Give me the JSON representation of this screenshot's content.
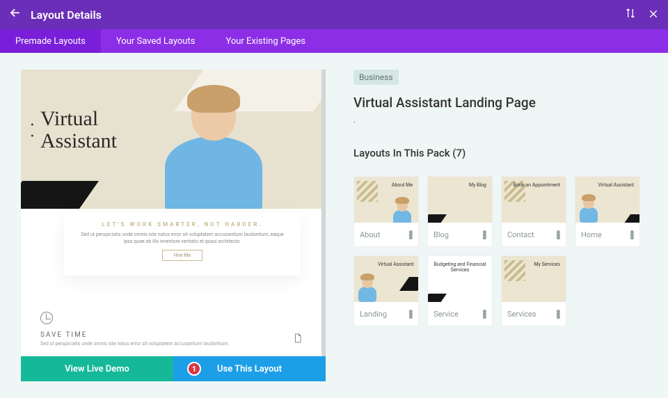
{
  "header": {
    "title": "Layout Details"
  },
  "tabs": {
    "premade": "Premade Layouts",
    "saved": "Your Saved Layouts",
    "existing": "Your Existing Pages"
  },
  "preview": {
    "heroLine1": "Virtual",
    "heroLine2": "Assistant",
    "cardTagline": "LET'S WORK SMARTER, NOT HARDER.",
    "cardText": "Sed ut perspiciatis unde omnis iste natus error sit voluptatem accusantium laudantium, eaque ipsa quae ab illo inventore veritatis et quasi architecto.",
    "cardBtn": "Hire Me",
    "saveHeading": "SAVE TIME",
    "saveText": "Sed ut perspiciatis unde omnis iste natus error sit voluptatem accusantium laudantium."
  },
  "actions": {
    "demo": "View Live Demo",
    "use": "Use This Layout",
    "badge": "1"
  },
  "info": {
    "category": "Business",
    "title": "Virtual Assistant Landing Page",
    "dot": ".",
    "sectionHeading": "Layouts In This Pack (7)"
  },
  "thumbs": {
    "about": "About",
    "blog": "Blog",
    "contact": "Contact",
    "home": "Home",
    "landing": "Landing",
    "service": "Service",
    "services": "Services",
    "t_about": "About Me",
    "t_blog": "My Blog",
    "t_contact": "Book an Appointment",
    "t_home": "Virtual Assistant",
    "t_landing": "Virtual Assistant",
    "t_service": "Budgeting and Financial Services",
    "t_services": "My Services"
  }
}
